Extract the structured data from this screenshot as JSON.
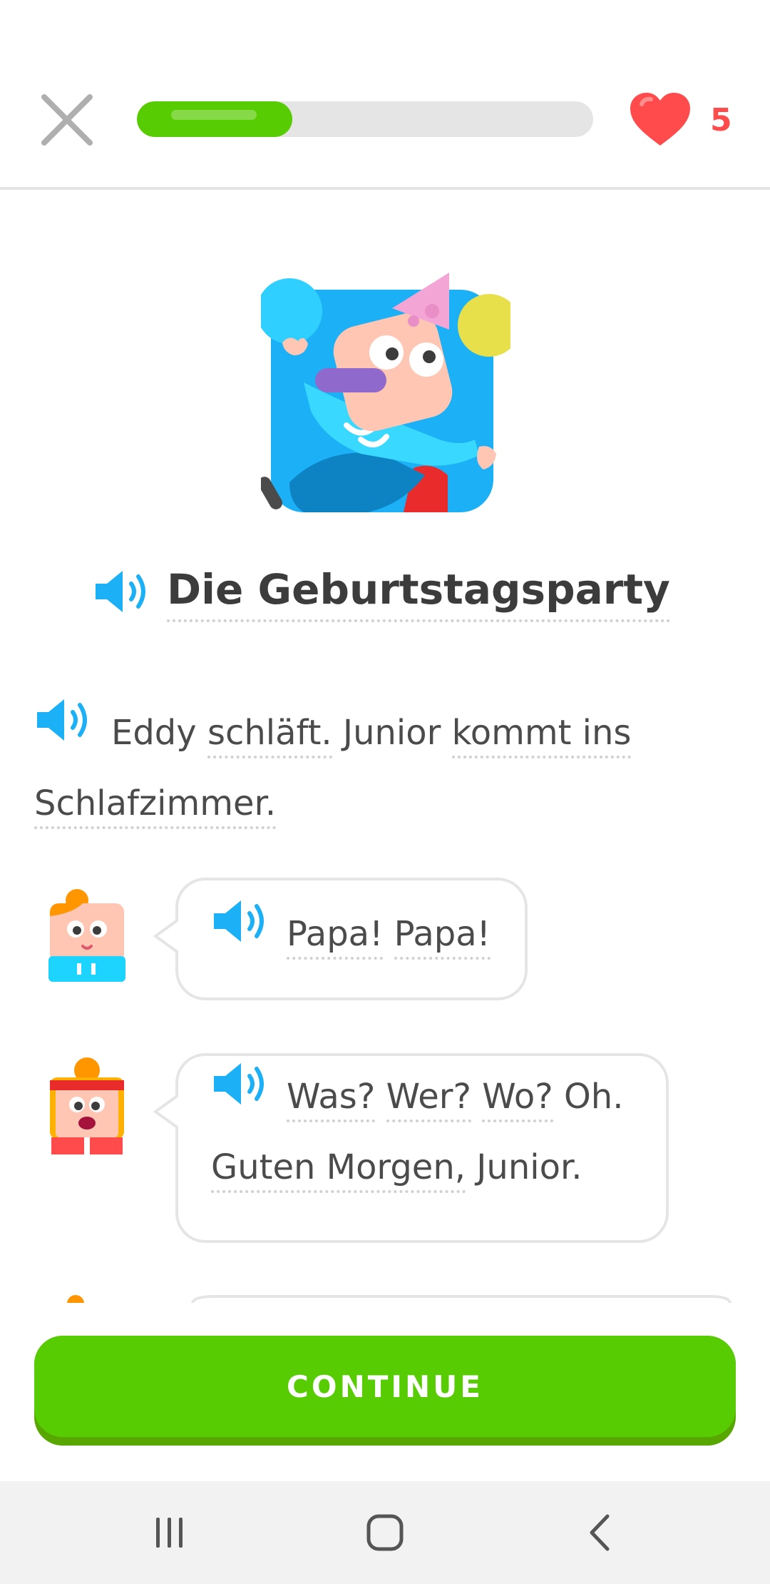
{
  "header": {
    "close_icon": "close-icon",
    "progress_fraction": 0.34,
    "hearts_count": "5",
    "accent_green": "#58cc02",
    "heart_color": "#ff4b4b"
  },
  "story": {
    "title": "Die Geburtstagsparty",
    "narration_line1_w1": "Eddy",
    "narration_line1_w2": "schläft.",
    "narration_line1_w3": "Junior",
    "narration_line1_w4": "kommt ins",
    "narration_line2": "Schlafzimmer.",
    "lines": [
      {
        "speaker": "Junior",
        "w1": "Papa!",
        "w2": "Papa!"
      },
      {
        "speaker": "Eddy",
        "w1": "Was?",
        "w2": "Wer?",
        "w3": "Wo?",
        "w4": "Oh.",
        "w5": "Guten Morgen,",
        "w6": "Junior."
      }
    ]
  },
  "footer": {
    "continue_label": "CONTINUE"
  },
  "system_nav": {
    "recents_icon": "recents-icon",
    "home_icon": "home-icon",
    "back_icon": "back-icon"
  }
}
